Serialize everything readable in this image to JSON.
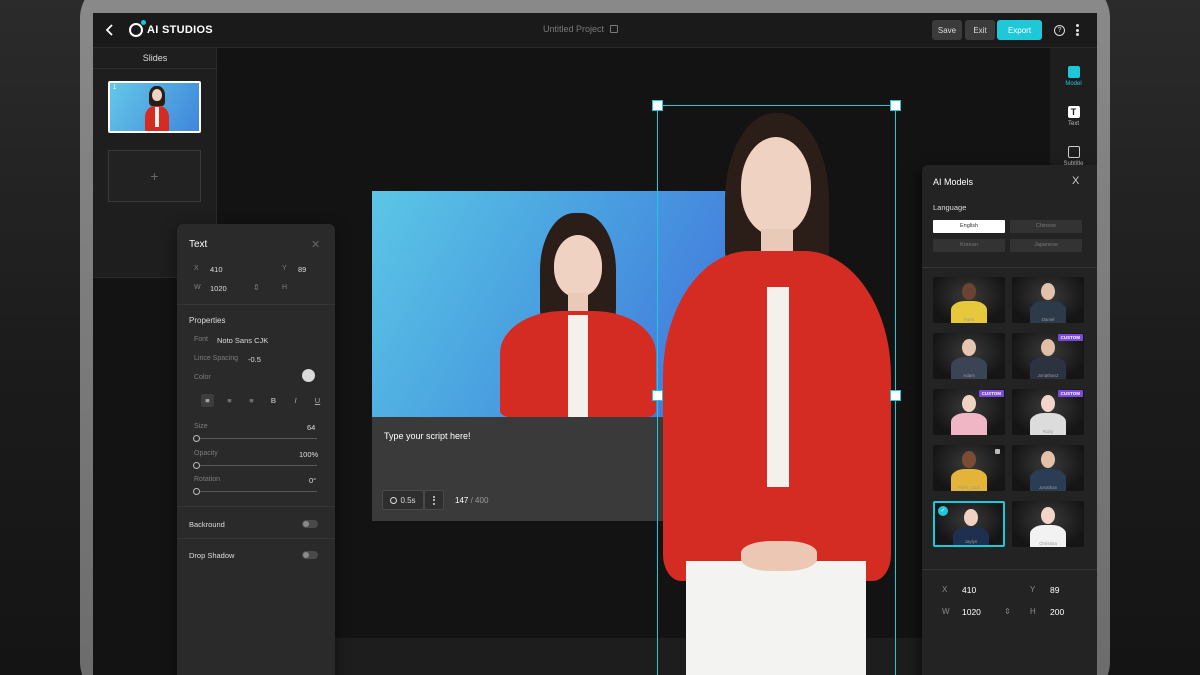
{
  "app": {
    "logo_text": "AI STUDIOS",
    "project_title": "Untitled Project"
  },
  "toolbar": {
    "save_label": "Save",
    "exit_label": "Exit",
    "export_label": "Export",
    "help_label": "?"
  },
  "slides": {
    "title": "Slides",
    "items": [
      {
        "number": "1"
      }
    ],
    "add_label": "+"
  },
  "script": {
    "placeholder": "Type your script here!",
    "duration": "0.5s",
    "char_count": "147",
    "char_max": "/ 400"
  },
  "right_tools": [
    {
      "label": "Model",
      "icon": "model-icon"
    },
    {
      "label": "Text",
      "icon": "text-icon",
      "glyph": "T"
    },
    {
      "label": "Subtitle",
      "icon": "subtitle-icon"
    }
  ],
  "text_panel": {
    "title": "Text",
    "close": "✕",
    "x_label": "X",
    "x_value": "410",
    "y_label": "Y",
    "y_value": "89",
    "w_label": "W",
    "w_value": "1020",
    "h_label": "H",
    "h_value": "",
    "link_icon": "link-icon",
    "properties_label": "Properties",
    "font_label": "Font",
    "font_value": "Noto Sans CJK",
    "line_spacing_label": "Lince Spacing",
    "line_spacing_value": "-0.5",
    "color_label": "Color",
    "color_value": "#d9d9d9",
    "align_buttons": [
      "≡",
      "≡",
      "≡",
      "B",
      "I",
      "U"
    ],
    "size_label": "Size",
    "size_value": "64",
    "size_level": 0,
    "opacity_label": "Opacity",
    "opacity_value": "100%",
    "opacity_level": 0,
    "rotation_label": "Rotation",
    "rotation_value": "0°",
    "rotation_level": 0,
    "background_label": "Backround",
    "background_on": false,
    "drop_shadow_label": "Drop Shadow",
    "drop_shadow_on": false
  },
  "models_panel": {
    "title": "AI Models",
    "close": "X",
    "language_label": "Language",
    "languages": [
      {
        "label": "English",
        "active": true
      },
      {
        "label": "Chinese",
        "active": false
      },
      {
        "label": "Korean",
        "active": false
      },
      {
        "label": "Japanese",
        "active": false
      }
    ],
    "models": [
      {
        "name": "Paris",
        "skin": "#6b4330",
        "outfit": "#e6c93a",
        "badge": ""
      },
      {
        "name": "Daniel",
        "skin": "#e2c2ab",
        "outfit": "#2d3a4a",
        "badge": ""
      },
      {
        "name": "Adam",
        "skin": "#e5c5ad",
        "outfit": "#3b4455",
        "badge": ""
      },
      {
        "name": "Jonathan2",
        "skin": "#e1bfa6",
        "outfit": "#2c3240",
        "badge": "CUSTOM"
      },
      {
        "name": "",
        "skin": "#efd2c1",
        "outfit": "#f0b6c6",
        "badge": "CUSTOM"
      },
      {
        "name": "Ruby",
        "skin": "#efd6c8",
        "outfit": "#dcdcdc",
        "badge": "CUSTOM"
      },
      {
        "name": "Paris_CEO",
        "skin": "#7a4c33",
        "outfit": "#e4b43a",
        "badge": "",
        "locked": true
      },
      {
        "name": "Jonathan",
        "skin": "#e3c2a9",
        "outfit": "#2b3c55",
        "badge": ""
      },
      {
        "name": "Jaylyn",
        "skin": "#efd2c1",
        "outfit": "#1f2f4f",
        "badge": "",
        "selected": true
      },
      {
        "name": "Christina",
        "skin": "#efd6c6",
        "outfit": "#f2f2f2",
        "badge": ""
      }
    ],
    "x_label": "X",
    "x_value": "410",
    "y_label": "Y",
    "y_value": "89",
    "w_label": "W",
    "w_value": "1020",
    "h_label": "H",
    "h_value": "200"
  }
}
